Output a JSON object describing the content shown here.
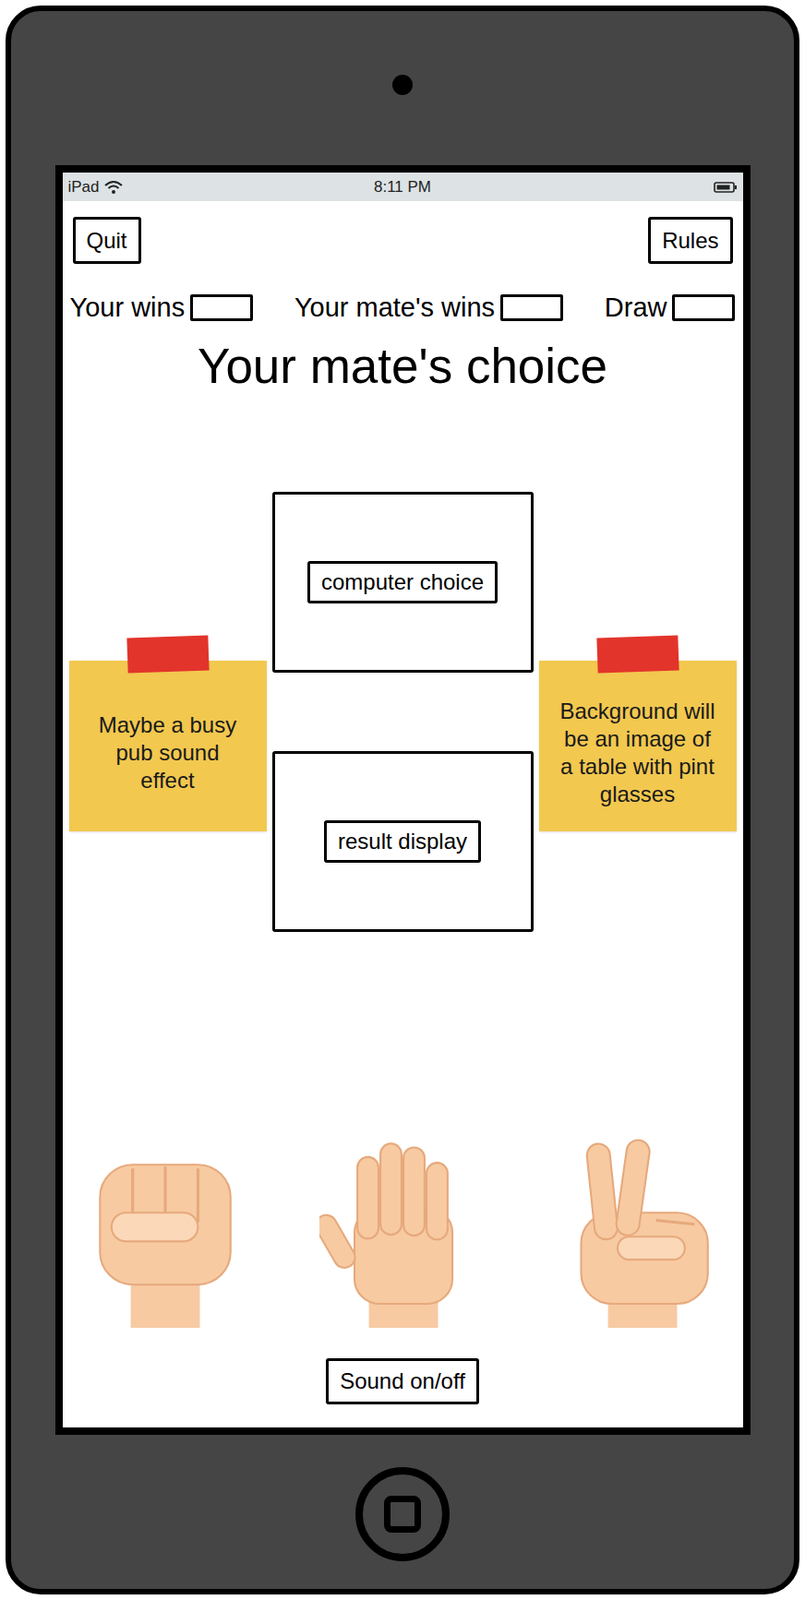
{
  "status_bar": {
    "device": "iPad",
    "time": "8:11 PM"
  },
  "top_buttons": {
    "quit": "Quit",
    "rules": "Rules"
  },
  "scores": [
    {
      "label": "Your wins"
    },
    {
      "label": "Your mate's wins"
    },
    {
      "label": "Draw"
    }
  ],
  "title": "Your mate's choice",
  "panels": [
    "computer choice",
    "result display"
  ],
  "notes": [
    {
      "text": "Maybe a busy pub sound effect"
    },
    {
      "text": "Background will be an image of a table with pint glasses"
    }
  ],
  "hands": [
    {
      "kind": "rock"
    },
    {
      "kind": "paper"
    },
    {
      "kind": "scissors"
    }
  ],
  "sound_button": "Sound on/off"
}
